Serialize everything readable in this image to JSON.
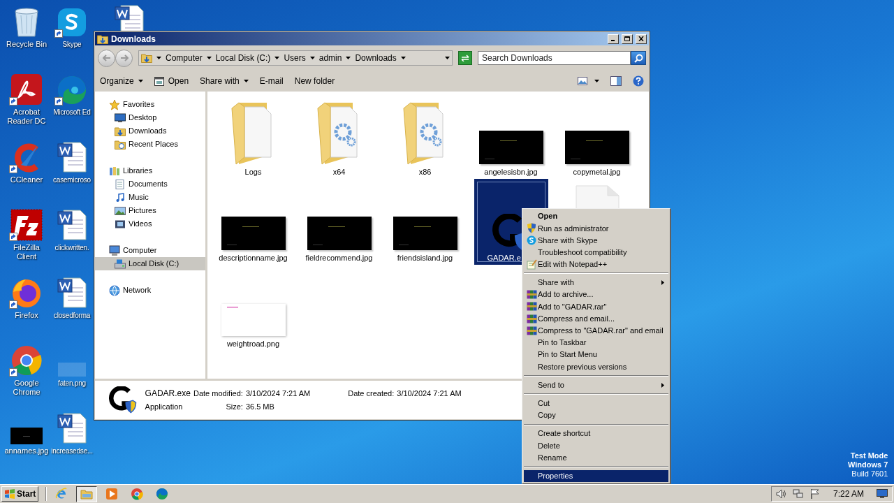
{
  "desktop": {
    "columns": [
      [
        {
          "label": "Recycle Bin",
          "kind": "recycle",
          "shortcut": false
        },
        {
          "label": "Acrobat Reader DC",
          "kind": "acrobat",
          "shortcut": true
        },
        {
          "label": "CCleaner",
          "kind": "ccleaner",
          "shortcut": true
        },
        {
          "label": "FileZilla Client",
          "kind": "filezilla",
          "shortcut": true
        },
        {
          "label": "Firefox",
          "kind": "firefox",
          "shortcut": true
        },
        {
          "label": "Google Chrome",
          "kind": "chrome",
          "shortcut": true
        },
        {
          "label": "annames.jpg",
          "kind": "darkimage",
          "shortcut": false
        }
      ],
      [
        {
          "label": "Skype",
          "kind": "skype",
          "shortcut": true
        },
        {
          "label": "Microsoft Ed",
          "kind": "edge",
          "shortcut": true
        },
        {
          "label": "casemicroso",
          "kind": "word",
          "shortcut": false
        },
        {
          "label": "clickwritten.",
          "kind": "word",
          "shortcut": false
        },
        {
          "label": "closedforma",
          "kind": "word",
          "shortcut": false
        },
        {
          "label": "faten.png",
          "kind": "faint",
          "shortcut": false
        },
        {
          "label": "increasedse...",
          "kind": "word",
          "shortcut": false
        }
      ]
    ]
  },
  "window": {
    "title": "Downloads",
    "breadcrumb": [
      "Computer",
      "Local Disk (C:)",
      "Users",
      "admin",
      "Downloads"
    ],
    "search": {
      "placeholder": "Search Downloads"
    },
    "toolbar": [
      {
        "label": "Organize",
        "kind": "menu"
      },
      {
        "label": "Open",
        "kind": "open"
      },
      {
        "label": "Share with",
        "kind": "menu"
      },
      {
        "label": "E-mail",
        "kind": "plain"
      },
      {
        "label": "New folder",
        "kind": "plain"
      }
    ],
    "nav": [
      {
        "label": "Favorites",
        "kind": "star",
        "selected": false,
        "children": [
          {
            "label": "Desktop",
            "kind": "desktop",
            "selected": false
          },
          {
            "label": "Downloads",
            "kind": "downloads",
            "selected": false
          },
          {
            "label": "Recent Places",
            "kind": "recent",
            "selected": false
          }
        ]
      },
      {
        "label": "Libraries",
        "kind": "library",
        "selected": false,
        "children": [
          {
            "label": "Documents",
            "kind": "documents",
            "selected": false
          },
          {
            "label": "Music",
            "kind": "music",
            "selected": false
          },
          {
            "label": "Pictures",
            "kind": "pictures",
            "selected": false
          },
          {
            "label": "Videos",
            "kind": "videos",
            "selected": false
          }
        ]
      },
      {
        "label": "Computer",
        "kind": "computer",
        "selected": false,
        "children": [
          {
            "label": "Local Disk (C:)",
            "kind": "disk",
            "selected": true
          }
        ]
      },
      {
        "label": "Network",
        "kind": "network",
        "selected": false
      }
    ],
    "items": [
      {
        "label": "Logs",
        "kind": "folder",
        "selected": false
      },
      {
        "label": "x64",
        "kind": "gearfolder",
        "selected": false
      },
      {
        "label": "x86",
        "kind": "gearfolder",
        "selected": false
      },
      {
        "label": "angelesisbn.jpg",
        "kind": "darkimage",
        "selected": false
      },
      {
        "label": "copymetal.jpg",
        "kind": "darkimage",
        "selected": false
      },
      {
        "label": "descriptionname.jpg",
        "kind": "darkimage",
        "selected": false
      },
      {
        "label": "fieldrecommend.jpg",
        "kind": "darkimage",
        "selected": false
      },
      {
        "label": "friendsisland.jpg",
        "kind": "darkimage",
        "selected": false
      },
      {
        "label": "GADAR.e",
        "kind": "program",
        "selected": true
      },
      {
        "kind": "blank",
        "selected": false
      },
      {
        "label": "weightroad.png",
        "kind": "lightimage",
        "selected": false
      }
    ],
    "details": {
      "name": "GADAR.exe",
      "type": "Application",
      "modified_label": "Date modified:",
      "modified": "3/10/2024 7:21 AM",
      "size_label": "Size:",
      "size": "36.5 MB",
      "created_label": "Date created:",
      "created": "3/10/2024 7:21 AM"
    }
  },
  "context_menu": [
    {
      "label": "Open",
      "kind": "default",
      "selected": false
    },
    {
      "label": "Run as administrator",
      "kind": "shield",
      "selected": false
    },
    {
      "label": "Share with Skype",
      "kind": "skype",
      "selected": false
    },
    {
      "label": "Troubleshoot compatibility",
      "kind": "plain",
      "selected": false
    },
    {
      "label": "Edit with Notepad++",
      "kind": "notepad",
      "selected": false
    },
    {
      "kind": "separator"
    },
    {
      "label": "Share with",
      "kind": "submenu",
      "selected": false
    },
    {
      "label": "Add to archive...",
      "kind": "archive",
      "selected": false
    },
    {
      "label": "Add to \"GADAR.rar\"",
      "kind": "archive",
      "selected": false
    },
    {
      "label": "Compress and email...",
      "kind": "archive",
      "selected": false
    },
    {
      "label": "Compress to \"GADAR.rar\" and email",
      "kind": "archive",
      "selected": false
    },
    {
      "label": "Pin to Taskbar",
      "kind": "plain",
      "selected": false
    },
    {
      "label": "Pin to Start Menu",
      "kind": "plain",
      "selected": false
    },
    {
      "label": "Restore previous versions",
      "kind": "plain",
      "selected": false
    },
    {
      "kind": "separator"
    },
    {
      "label": "Send to",
      "kind": "submenu",
      "selected": false
    },
    {
      "kind": "separator"
    },
    {
      "label": "Cut",
      "kind": "plain",
      "selected": false
    },
    {
      "label": "Copy",
      "kind": "plain",
      "selected": false
    },
    {
      "kind": "separator"
    },
    {
      "label": "Create shortcut",
      "kind": "plain",
      "selected": false
    },
    {
      "label": "Delete",
      "kind": "plain",
      "selected": false
    },
    {
      "label": "Rename",
      "kind": "plain",
      "selected": false
    },
    {
      "kind": "separator"
    },
    {
      "label": "Properties",
      "kind": "plain",
      "selected": true
    }
  ],
  "watermark_text": [
    "Test Mode",
    "Windows 7",
    "Build 7601"
  ],
  "taskbar": {
    "start": "Start",
    "apps": [
      {
        "kind": "ie",
        "selected": false
      },
      {
        "kind": "explorer",
        "selected": true
      },
      {
        "kind": "media",
        "selected": false
      },
      {
        "kind": "chrome",
        "selected": false
      },
      {
        "kind": "edge",
        "selected": false
      }
    ],
    "clock": "7:22 AM"
  }
}
